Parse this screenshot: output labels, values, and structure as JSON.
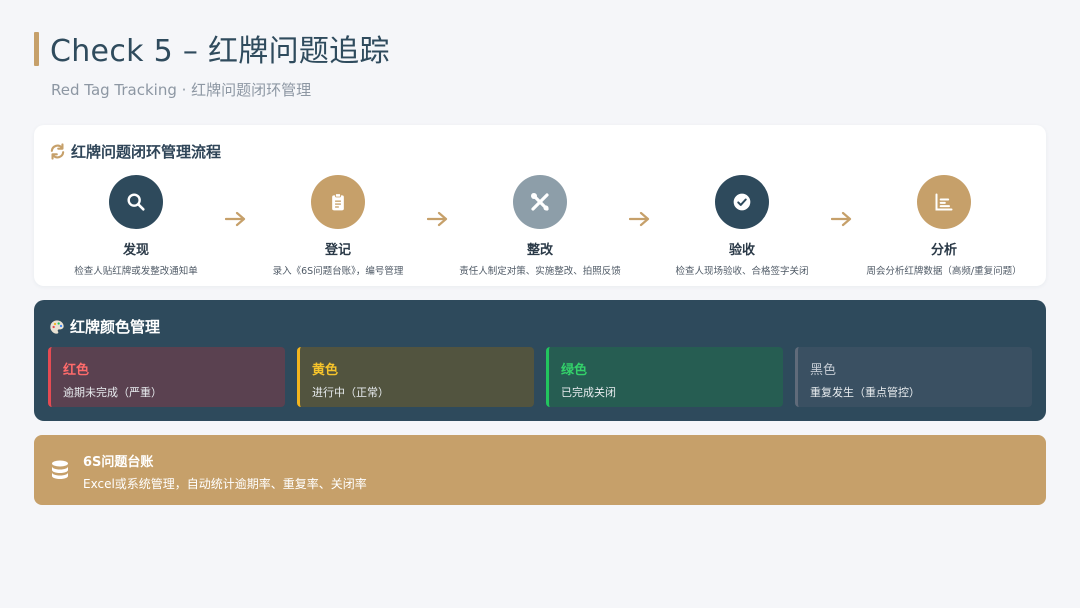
{
  "header": {
    "title": "Check 5 – 红牌问题追踪",
    "subtitle": "Red Tag Tracking · 红牌问题闭环管理"
  },
  "process": {
    "heading": "红牌问题闭环管理流程",
    "heading_icon": "refresh-icon",
    "steps": [
      {
        "label": "发现",
        "desc": "检查人贴红牌或发整改通知单",
        "icon": "search-icon",
        "color": "#2e4a5c"
      },
      {
        "label": "登记",
        "desc": "录入《6S问题台账》，编号管理",
        "icon": "clipboard-icon",
        "color": "#c6a06a"
      },
      {
        "label": "整改",
        "desc": "责任人制定对策、实施整改、拍照反馈",
        "icon": "tools-icon",
        "color": "#8d9ea9"
      },
      {
        "label": "验收",
        "desc": "检查人现场验收、合格签字关闭",
        "icon": "check-circle-icon",
        "color": "#2e4a5c"
      },
      {
        "label": "分析",
        "desc": "周会分析红牌数据（高频/重复问题）",
        "icon": "chart-icon",
        "color": "#c6a06a"
      }
    ]
  },
  "colors": {
    "heading": "红牌颜色管理",
    "heading_icon": "palette-icon",
    "tags": [
      {
        "name": "红色",
        "desc": "逾期未完成（严重）",
        "accent": "#e54b53",
        "name_color": "#ff6b6b",
        "bg": "#5a4150"
      },
      {
        "name": "黄色",
        "desc": "进行中（正常）",
        "accent": "#f2b51f",
        "name_color": "#f7c42b",
        "bg": "#52543f"
      },
      {
        "name": "绿色",
        "desc": "已完成关闭",
        "accent": "#22c55e",
        "name_color": "#33d16a",
        "bg": "#265d52"
      },
      {
        "name": "黑色",
        "desc": "重复发生（重点管控）",
        "accent": "#606b7a",
        "name_color": "#c3cad2",
        "bg": "#3a5062"
      }
    ]
  },
  "ledger": {
    "title": "6S问题台账",
    "desc": "Excel或系统管理，自动统计逾期率、重复率、关闭率",
    "icon": "database-icon"
  }
}
